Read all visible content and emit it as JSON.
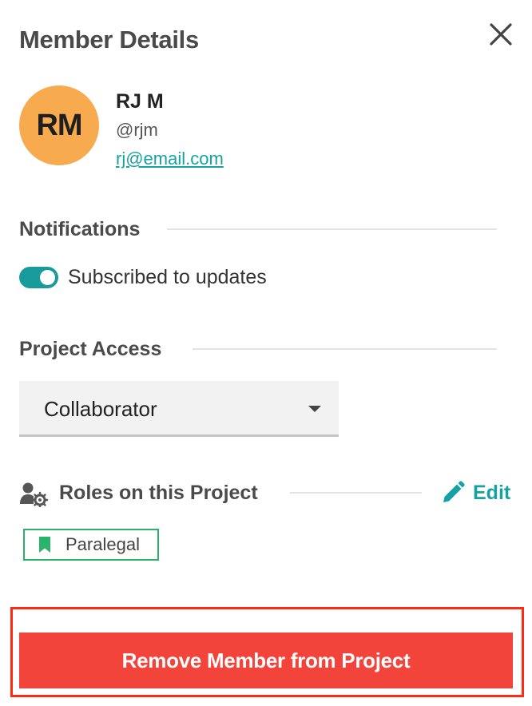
{
  "panel": {
    "title": "Member Details"
  },
  "member": {
    "initials": "RM",
    "name": "RJ M",
    "handle": "@rjm",
    "email": "rj@email.com",
    "avatar_color": "#f7ab4e"
  },
  "notifications": {
    "heading": "Notifications",
    "toggle_label": "Subscribed to updates",
    "subscribed": true,
    "toggle_color": "#1a9b9b"
  },
  "access": {
    "heading": "Project Access",
    "selected": "Collaborator"
  },
  "roles": {
    "heading": "Roles on this Project",
    "edit_label": "Edit",
    "items": [
      {
        "label": "Paralegal",
        "color": "#2bb36b"
      }
    ]
  },
  "actions": {
    "remove_label": "Remove Member from Project",
    "remove_color": "#f2443a",
    "highlight_color": "#ff2a12"
  },
  "icons": {
    "close": "close-icon",
    "roles": "user-gear-icon",
    "edit": "pencil-icon",
    "tag": "bookmark-icon",
    "caret": "caret-down-icon"
  }
}
